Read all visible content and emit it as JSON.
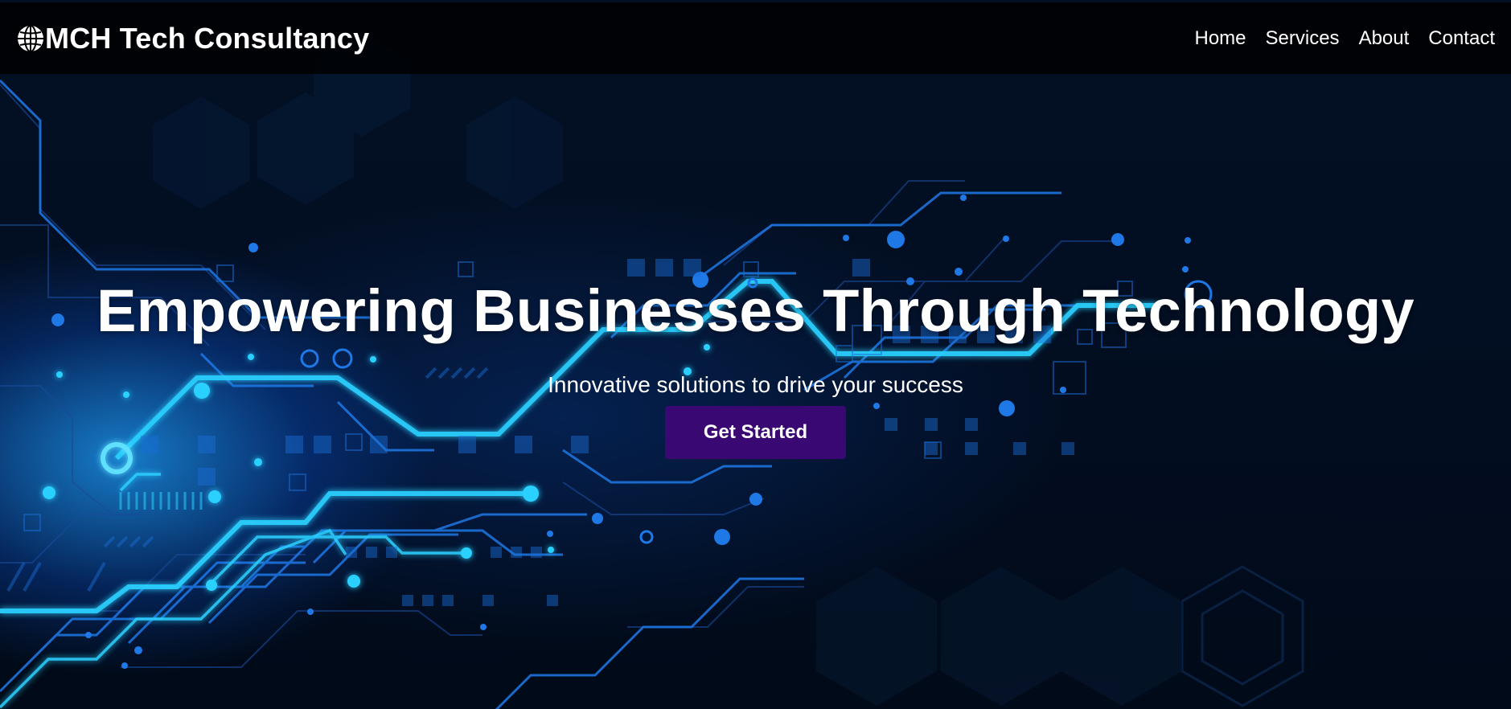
{
  "brand": {
    "icon": "globe-icon",
    "name": "MCH Tech Consultancy"
  },
  "nav": {
    "items": [
      {
        "label": "Home"
      },
      {
        "label": "Services"
      },
      {
        "label": "About"
      },
      {
        "label": "Contact"
      }
    ]
  },
  "hero": {
    "title": "Empowering Businesses Through Technology",
    "subtitle": "Innovative solutions to drive your success",
    "cta_label": "Get Started",
    "background": "circuit-board-image"
  },
  "colors": {
    "navbar_bg": "#000000",
    "cta_bg": "#3a0872",
    "text": "#ffffff",
    "circuit_glow": "#29c4ff",
    "page_bg": "#020c1c"
  }
}
